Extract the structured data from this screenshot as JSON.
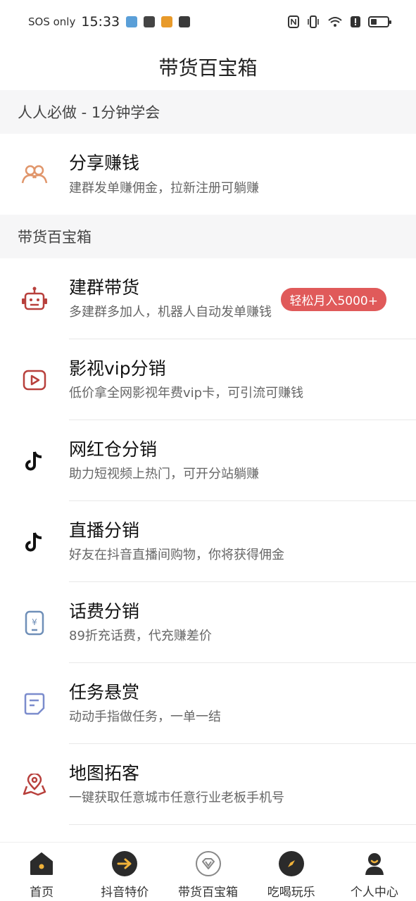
{
  "status_bar": {
    "carrier": "SOS only",
    "time": "15:33"
  },
  "title": "带货百宝箱",
  "sections": [
    {
      "header": "人人必做 - 1分钟学会",
      "items": [
        {
          "title": "分享赚钱",
          "desc": "建群发单赚佣金，拉新注册可躺赚",
          "icon": "people-icon"
        }
      ]
    },
    {
      "header": "带货百宝箱",
      "items": [
        {
          "title": "建群带货",
          "desc": "多建群多加人，机器人自动发单赚钱",
          "icon": "robot-icon",
          "badge": "轻松月入5000+"
        },
        {
          "title": "影视vip分销",
          "desc": "低价拿全网影视年费vip卡，可引流可赚钱",
          "icon": "video-play-icon"
        },
        {
          "title": "网红仓分销",
          "desc": "助力短视频上热门，可开分站躺赚",
          "icon": "tiktok-icon"
        },
        {
          "title": "直播分销",
          "desc": "好友在抖音直播间购物，你将获得佣金",
          "icon": "tiktok-icon"
        },
        {
          "title": "话费分销",
          "desc": "89折充话费，代充赚差价",
          "icon": "phone-bill-icon"
        },
        {
          "title": "任务悬赏",
          "desc": "动动手指做任务，一单一结",
          "icon": "task-icon"
        },
        {
          "title": "地图拓客",
          "desc": "一键获取任意城市任意行业老板手机号",
          "icon": "map-pin-icon"
        }
      ]
    }
  ],
  "bottom_nav": [
    {
      "label": "首页",
      "icon": "home-icon"
    },
    {
      "label": "抖音特价",
      "icon": "arrow-right-icon"
    },
    {
      "label": "带货百宝箱",
      "icon": "diamond-icon"
    },
    {
      "label": "吃喝玩乐",
      "icon": "compass-icon"
    },
    {
      "label": "个人中心",
      "icon": "user-icon"
    }
  ],
  "colors": {
    "accent_red": "#b8403c",
    "badge_red": "#e05a5a",
    "section_bg": "#f6f6f7",
    "people_icon": "#e0956a",
    "bill_icon": "#6f8fb8",
    "task_icon": "#7b8ccd"
  }
}
